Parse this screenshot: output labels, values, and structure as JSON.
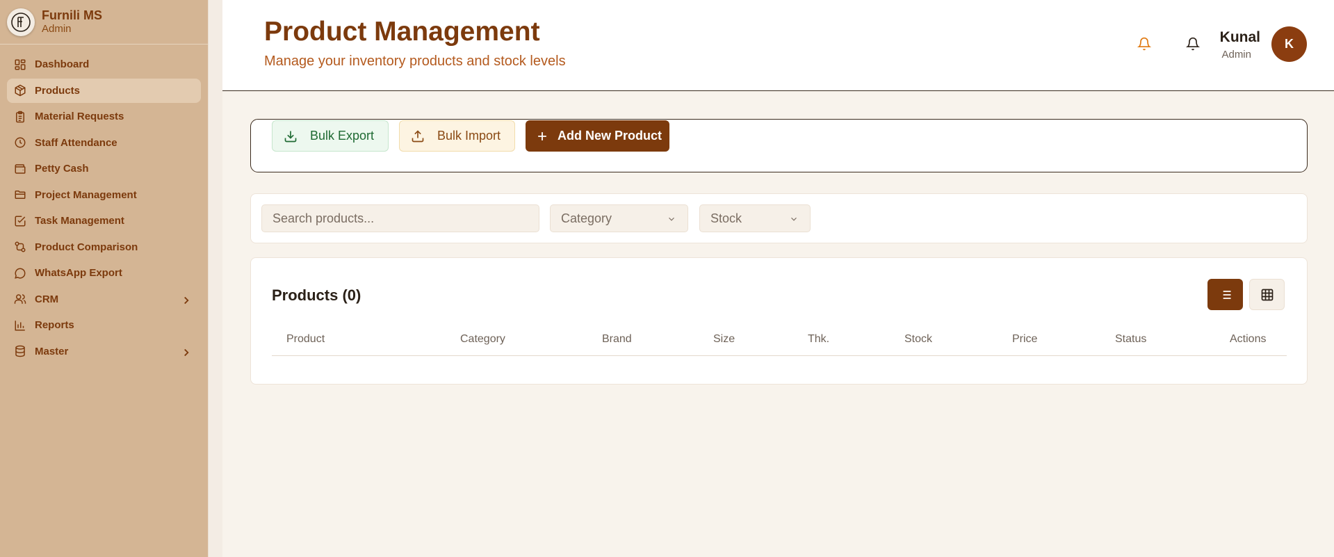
{
  "brand": {
    "name": "Furnili MS",
    "role": "Admin",
    "logo_letter": "F"
  },
  "sidebar": {
    "items": [
      {
        "label": "Dashboard",
        "icon": "layout-grid-icon"
      },
      {
        "label": "Products",
        "icon": "package-icon",
        "active": true
      },
      {
        "label": "Material Requests",
        "icon": "clipboard-icon"
      },
      {
        "label": "Staff Attendance",
        "icon": "clock-icon"
      },
      {
        "label": "Petty Cash",
        "icon": "wallet-icon"
      },
      {
        "label": "Project Management",
        "icon": "folder-icon"
      },
      {
        "label": "Task Management",
        "icon": "check-square-icon"
      },
      {
        "label": "Product Comparison",
        "icon": "compare-icon"
      },
      {
        "label": "WhatsApp Export",
        "icon": "message-circle-icon"
      },
      {
        "label": "CRM",
        "icon": "users-icon",
        "has_submenu": true
      },
      {
        "label": "Reports",
        "icon": "bar-chart-icon"
      },
      {
        "label": "Master",
        "icon": "database-icon",
        "has_submenu": true
      }
    ]
  },
  "header": {
    "title": "Product Management",
    "subtitle": "Manage your inventory products and stock levels",
    "user": {
      "name": "Kunal",
      "role": "Admin",
      "initial": "K"
    }
  },
  "toolbar": {
    "bulk_export_label": "Bulk Export",
    "bulk_import_label": "Bulk Import",
    "add_product_label": "Add New Product"
  },
  "filters": {
    "search_placeholder": "Search products...",
    "category_label": "Category",
    "stock_label": "Stock"
  },
  "products": {
    "title": "Products (0)",
    "columns": [
      "Product",
      "Category",
      "Brand",
      "Size",
      "Thk.",
      "Stock",
      "Price",
      "Status",
      "Actions"
    ],
    "rows": []
  },
  "colors": {
    "accent": "#7c3a0d",
    "sidebar_bg": "#d4b594",
    "export_green": "#1f6a33",
    "notification_orange": "#e0780e"
  }
}
